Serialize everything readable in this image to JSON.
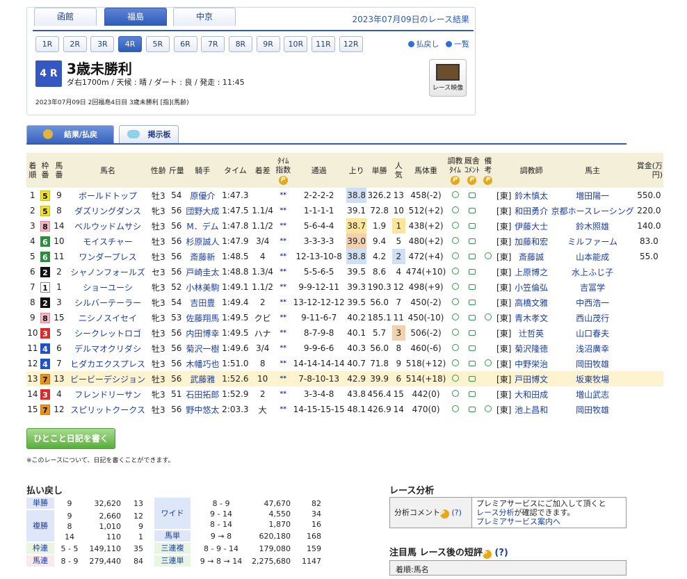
{
  "venue_tabs": [
    "函館",
    "福島",
    "中京"
  ],
  "active_venue": "福島",
  "result_date": "2023年07月09日のレース結果",
  "race_numbers": [
    "1R",
    "2R",
    "3R",
    "4R",
    "5R",
    "6R",
    "7R",
    "8R",
    "9R",
    "10R",
    "11R",
    "12R"
  ],
  "active_race": "4R",
  "links": {
    "payout": "払戻し",
    "list": "一覧"
  },
  "race": {
    "badge": "4 R",
    "title": "3歳未勝利",
    "conditions": "ダ右1700m /  天候 : 晴 /  ダート : 良  /  発走 : 11:45",
    "info": "2023年07月09日 2回福島4日目 3歳未勝利  [指](馬齢)",
    "video_label": "レース映像"
  },
  "subtabs": {
    "results": "結果/払戻",
    "board": "掲示板"
  },
  "headers": {
    "rank": "着順",
    "waku": "枠番",
    "umaban": "馬番",
    "name": "馬名",
    "sexage": "性齢",
    "weight": "斤量",
    "jockey": "騎手",
    "time": "タイム",
    "margin": "着差",
    "index": "ﾀｲﾑ指数",
    "passing": "通過",
    "last3f": "上り",
    "odds": "単勝",
    "pop": "人気",
    "body": "馬体重",
    "traintime": "調教ﾀｲﾑ",
    "comment": "厩舎ｺﾒﾝﾄ",
    "remarks": "備考",
    "trainer": "調教師",
    "owner": "馬主",
    "prize": "賞金(万円)"
  },
  "rows": [
    {
      "rank": "1",
      "waku": "5",
      "umaban": "9",
      "name": "ボールドトップ",
      "sexage": "牡3",
      "weight": "54",
      "jockey": "原優介",
      "time": "1:47.3",
      "margin": "",
      "index": "**",
      "passing": "2-2-2-2",
      "last3f": "38.8",
      "l3": "hb1",
      "odds": "326.2",
      "pop": "13",
      "pb": "",
      "body": "458(-2)",
      "note": false,
      "region": "[東]",
      "trainer": "鈴木慎太",
      "owner": "増田陽一",
      "prize": "550.0"
    },
    {
      "rank": "2",
      "waku": "5",
      "umaban": "8",
      "name": "ダズリングダンス",
      "sexage": "牝3",
      "weight": "56",
      "jockey": "団野大成",
      "time": "1:47.5",
      "margin": "1.1/4",
      "index": "**",
      "passing": "1-1-1-1",
      "last3f": "39.1",
      "l3": "",
      "odds": "72.8",
      "pop": "10",
      "pb": "",
      "body": "512(+2)",
      "note": false,
      "region": "[東]",
      "trainer": "和田勇介",
      "owner": "京都ホースレーシング",
      "prize": "220.0"
    },
    {
      "rank": "3",
      "waku": "8",
      "umaban": "14",
      "name": "ベルウッドムサシ",
      "sexage": "牡3",
      "weight": "56",
      "jockey": "M．デム",
      "time": "1:47.8",
      "margin": "1.1/2",
      "index": "**",
      "passing": "5-6-4-4",
      "last3f": "38.7",
      "l3": "hb2",
      "odds": "1.9",
      "pop": "1",
      "pb": "hb2",
      "body": "438(+2)",
      "note": false,
      "region": "[東]",
      "trainer": "伊藤大士",
      "owner": "鈴木照雄",
      "prize": "140.0"
    },
    {
      "rank": "4",
      "waku": "6",
      "umaban": "10",
      "name": "モイスチャー",
      "sexage": "牡3",
      "weight": "56",
      "jockey": "杉原誠人",
      "time": "1:47.9",
      "margin": "3/4",
      "index": "**",
      "passing": "3-3-3-3",
      "last3f": "39.0",
      "l3": "hb3",
      "odds": "9.4",
      "pop": "5",
      "pb": "",
      "body": "480(+2)",
      "note": false,
      "region": "[東]",
      "trainer": "加藤和宏",
      "owner": "ミルファーム",
      "prize": "83.0"
    },
    {
      "rank": "5",
      "waku": "6",
      "umaban": "11",
      "name": "ワンダープレス",
      "sexage": "牡3",
      "weight": "56",
      "jockey": "斎藤新",
      "time": "1:48.5",
      "margin": "4",
      "index": "**",
      "passing": "12-13-10-8",
      "last3f": "38.8",
      "l3": "hb1",
      "odds": "4.2",
      "pop": "2",
      "pb": "hb1",
      "body": "472(+4)",
      "note": true,
      "region": "[東]",
      "trainer": "斎藤誠",
      "owner": "山本能成",
      "prize": "55.0"
    },
    {
      "rank": "6",
      "waku": "2",
      "umaban": "2",
      "name": "シャノンフォールズ",
      "sexage": "セ3",
      "weight": "56",
      "jockey": "戸崎圭太",
      "time": "1:48.8",
      "margin": "1.3/4",
      "index": "**",
      "passing": "5-5-6-5",
      "last3f": "39.5",
      "l3": "",
      "odds": "8.6",
      "pop": "4",
      "pb": "",
      "body": "474(+10)",
      "note": false,
      "region": "[東]",
      "trainer": "上原博之",
      "owner": "水上ふじ子",
      "prize": ""
    },
    {
      "rank": "7",
      "waku": "1",
      "umaban": "1",
      "name": "ショーユーシ",
      "sexage": "牝3",
      "weight": "52",
      "jockey": "小林美駒",
      "time": "1:49.1",
      "margin": "1.1/2",
      "index": "**",
      "passing": "9-9-12-11",
      "last3f": "39.3",
      "l3": "",
      "odds": "190.3",
      "pop": "12",
      "pb": "",
      "body": "498(+9)",
      "note": false,
      "region": "[東]",
      "trainer": "小笠倫弘",
      "owner": "吉冨学",
      "prize": ""
    },
    {
      "rank": "8",
      "waku": "2",
      "umaban": "3",
      "name": "シルバーテーラー",
      "sexage": "牝3",
      "weight": "54",
      "jockey": "吉田豊",
      "time": "1:49.4",
      "margin": "2",
      "index": "**",
      "passing": "13-12-12-12",
      "last3f": "39.5",
      "l3": "",
      "odds": "56.0",
      "pop": "7",
      "pb": "",
      "body": "450(-2)",
      "note": false,
      "region": "[東]",
      "trainer": "高橋文雅",
      "owner": "中西浩一",
      "prize": ""
    },
    {
      "rank": "9",
      "waku": "8",
      "umaban": "15",
      "name": "ニシノスイセイ",
      "sexage": "牝3",
      "weight": "53",
      "jockey": "佐藤翔馬",
      "time": "1:49.5",
      "margin": "クビ",
      "index": "**",
      "passing": "9-11-6-7",
      "last3f": "40.2",
      "l3": "",
      "odds": "185.1",
      "pop": "11",
      "pb": "",
      "body": "450(-10)",
      "note": true,
      "region": "[東]",
      "trainer": "青木孝文",
      "owner": "西山茂行",
      "prize": ""
    },
    {
      "rank": "10",
      "waku": "3",
      "umaban": "5",
      "name": "シークレットロゴ",
      "sexage": "牡3",
      "weight": "56",
      "jockey": "内田博幸",
      "time": "1:49.5",
      "margin": "ハナ",
      "index": "**",
      "passing": "8-7-9-8",
      "last3f": "40.1",
      "l3": "",
      "odds": "5.7",
      "pop": "3",
      "pb": "hb3",
      "body": "506(-2)",
      "note": false,
      "region": "[東]",
      "trainer": "辻哲英",
      "owner": "山口春夫",
      "prize": ""
    },
    {
      "rank": "11",
      "waku": "4",
      "umaban": "6",
      "name": "デルマオクリダシ",
      "sexage": "牡3",
      "weight": "56",
      "jockey": "菊沢一樹",
      "time": "1:49.6",
      "margin": "3/4",
      "index": "**",
      "passing": "9-9-6-6",
      "last3f": "40.3",
      "l3": "",
      "odds": "56.0",
      "pop": "8",
      "pb": "",
      "body": "460(-6)",
      "note": false,
      "region": "[東]",
      "trainer": "菊沢隆徳",
      "owner": "浅沼廣幸",
      "prize": ""
    },
    {
      "rank": "12",
      "waku": "4",
      "umaban": "7",
      "name": "ヒダカエクスプレス",
      "sexage": "牡3",
      "weight": "56",
      "jockey": "木幡巧也",
      "time": "1:51.0",
      "margin": "8",
      "index": "**",
      "passing": "14-14-14-14",
      "last3f": "40.7",
      "l3": "",
      "odds": "71.8",
      "pop": "9",
      "pb": "",
      "body": "518(+12)",
      "note": true,
      "region": "[東]",
      "trainer": "中野栄治",
      "owner": "岡田牧雄",
      "prize": ""
    },
    {
      "rank": "13",
      "waku": "7",
      "umaban": "13",
      "name": "ビービーデシジョン",
      "sexage": "牡3",
      "weight": "56",
      "jockey": "武藤雅",
      "time": "1:52.6",
      "margin": "10",
      "index": "**",
      "passing": "7-8-10-13",
      "last3f": "42.9",
      "l3": "",
      "odds": "39.9",
      "pop": "6",
      "pb": "",
      "body": "514(+18)",
      "note": false,
      "region": "[東]",
      "trainer": "戸田博文",
      "owner": "坂東牧場",
      "prize": "",
      "hl": true
    },
    {
      "rank": "14",
      "waku": "3",
      "umaban": "4",
      "name": "フレンドリーサン",
      "sexage": "牝3",
      "weight": "51",
      "jockey": "石田拓郎",
      "time": "1:52.9",
      "margin": "2",
      "index": "**",
      "passing": "3-3-4-8",
      "last3f": "43.8",
      "l3": "",
      "odds": "456.4",
      "pop": "15",
      "pb": "",
      "body": "442(0)",
      "note": false,
      "region": "[東]",
      "trainer": "大和田成",
      "owner": "増山武志",
      "prize": ""
    },
    {
      "rank": "15",
      "waku": "7",
      "umaban": "12",
      "name": "スピリットクークス",
      "sexage": "牡3",
      "weight": "56",
      "jockey": "野中悠太",
      "time": "2:03.3",
      "margin": "大",
      "index": "**",
      "passing": "14-15-15-15",
      "last3f": "48.1",
      "l3": "",
      "odds": "426.9",
      "pop": "14",
      "pb": "",
      "body": "470(0)",
      "note": true,
      "region": "[東]",
      "trainer": "池上昌和",
      "owner": "岡田牧雄",
      "prize": ""
    }
  ],
  "diary": {
    "button": "ひとこと日記を書く",
    "note": "※このレースについて、日記を書くことができます。"
  },
  "payout": {
    "title": "払い戻し",
    "tansho": {
      "label": "単勝",
      "rows": [
        [
          "9",
          "32,620",
          "13"
        ]
      ]
    },
    "fukusho": {
      "label": "複勝",
      "rows": [
        [
          "9",
          "2,660",
          "12"
        ],
        [
          "8",
          "1,010",
          "9"
        ],
        [
          "14",
          "110",
          "1"
        ]
      ]
    },
    "wakuren": {
      "label": "枠連",
      "rows": [
        [
          "5 - 5",
          "149,110",
          "35"
        ]
      ]
    },
    "umaren": {
      "label": "馬連",
      "rows": [
        [
          "8 - 9",
          "279,440",
          "84"
        ]
      ]
    },
    "wide": {
      "label": "ワイド",
      "rows": [
        [
          "8 - 9",
          "47,670",
          "82"
        ],
        [
          "9 - 14",
          "4,550",
          "34"
        ],
        [
          "8 - 14",
          "1,870",
          "16"
        ]
      ]
    },
    "umatan": {
      "label": "馬単",
      "rows": [
        [
          "9 → 8",
          "620,180",
          "168"
        ]
      ]
    },
    "sanrenpuku": {
      "label": "三連複",
      "rows": [
        [
          "8 - 9 - 14",
          "179,080",
          "159"
        ]
      ]
    },
    "sanrentan": {
      "label": "三連単",
      "rows": [
        [
          "9 → 8 → 14",
          "2,275,680",
          "1147"
        ]
      ]
    }
  },
  "analysis": {
    "title": "レース分析",
    "label": "分析コメント",
    "help": "(?)",
    "line1": "プレミアサービスにご加入して頂くと",
    "line2": "レース分析が確認できます。",
    "line3": "プレミアサービス案内へ"
  },
  "pick": {
    "title": "注目馬 レース後の短評",
    "help": "(?)",
    "head": "着順:馬名"
  },
  "pmark": "P"
}
